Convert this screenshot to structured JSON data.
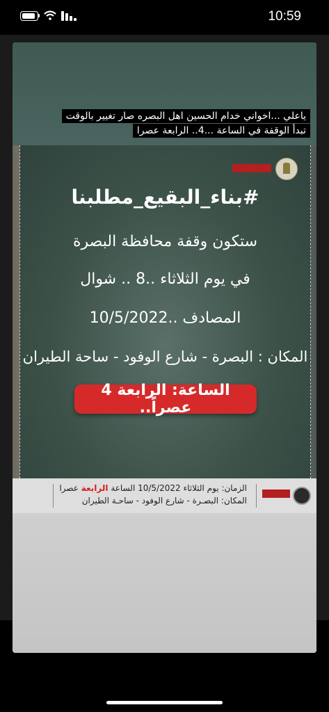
{
  "status_bar": {
    "time": "10:59"
  },
  "story": {
    "caption_lines": [
      "ياعلي ...اخواني خدام الحسين اهل البصره صار تغيير بالوقت",
      "تبدأ الوقفة في الساعة ...4.. الرابعة عصرا"
    ]
  },
  "poster": {
    "hashtag": "#بناء_البقيع_مطلبنا",
    "line1": "ستكون وقفة محافظة البصرة",
    "line2": "في يوم الثلاثاء ..8 .. شوال",
    "line3": "المصادف ..10/5/2022",
    "line4": "المكان : البصرة - شارع الوفود - ساحة الطيران",
    "time_badge": "الساعة: الرابعة 4 عصراً.."
  },
  "info_bar": {
    "time_prefix": "الزمان: يوم الثلاثاء 10/5/2022 الساعة ",
    "time_highlight": "الرابعة",
    "time_suffix": " عصرا",
    "place": "المكان: البصـرة - شارع الوفود - ساحـة الطيران"
  },
  "colors": {
    "accent_red": "#d62a2a",
    "poster_green": "#3c5148"
  }
}
